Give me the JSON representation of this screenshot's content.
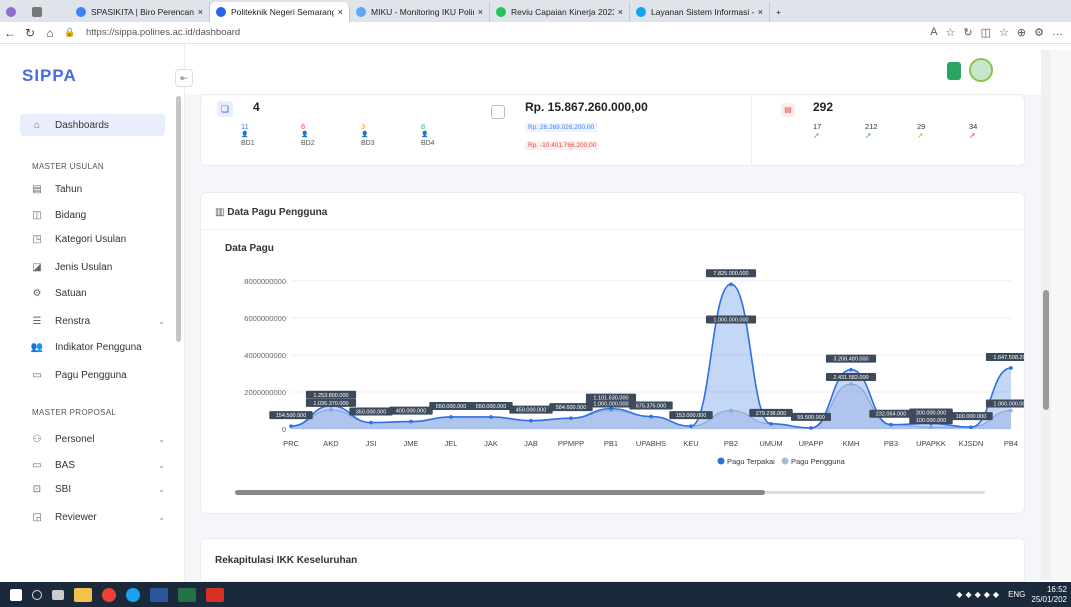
{
  "browser": {
    "tabs": [
      {
        "label": "SPASIKITA | Biro Perencanaan",
        "color": "#3b82f6",
        "active": false
      },
      {
        "label": "Politeknik Negeri Semarang - Da",
        "color": "#2563eb",
        "active": true
      },
      {
        "label": "MIKU - Monitoring IKU Polines",
        "color": "#60a5fa",
        "active": false
      },
      {
        "label": "Reviu Capaian Kinerja 2023 - Ren",
        "color": "#22c55e",
        "active": false
      },
      {
        "label": "Layanan Sistem Informasi - POLI",
        "color": "#0ea5e9",
        "active": false
      }
    ],
    "url": "https://sippa.polines.ac.id/dashboard"
  },
  "sidebar": {
    "logo": "SIPPA",
    "collapse_icon": "⇤",
    "items": [
      {
        "label": "Dashboards",
        "icon": "⌂",
        "active": true
      },
      {
        "label": "Tahun",
        "icon": "▤"
      },
      {
        "label": "Bidang",
        "icon": "◫"
      },
      {
        "label": "Kategori Usulan",
        "icon": "◳"
      },
      {
        "label": "Jenis Usulan",
        "icon": "◪"
      },
      {
        "label": "Satuan",
        "icon": "⚙"
      },
      {
        "label": "Renstra",
        "icon": "☰",
        "chev": "⌄"
      },
      {
        "label": "Indikator Pengguna",
        "icon": "👥"
      },
      {
        "label": "Pagu Pengguna",
        "icon": "▭"
      },
      {
        "label": "Personel",
        "icon": "⚇",
        "chev": "⌄"
      },
      {
        "label": "BAS",
        "icon": "▭",
        "chev": "⌄"
      },
      {
        "label": "SBI",
        "icon": "⊡",
        "chev": "⌄"
      },
      {
        "label": "Reviewer",
        "icon": "◲",
        "chev": "⌄"
      }
    ],
    "section_usulan": "MASTER USULAN",
    "section_proposal": "MASTER PROPOSAL"
  },
  "stats": {
    "bidang_count": "4",
    "bd": [
      {
        "value": "11",
        "label": "BD1",
        "color": "#3b82f6"
      },
      {
        "value": "6",
        "label": "BD2",
        "color": "#ef4444"
      },
      {
        "value": "3",
        "label": "BD3",
        "color": "#f59e0b"
      },
      {
        "value": "8",
        "label": "BD4",
        "color": "#22c55e"
      }
    ],
    "pagu_total": "Rp. 15.867.260.000,00",
    "pagu_used": "Rp. 26.269.026.200,00",
    "pagu_remaining": "Rp. -10.401.766.200,00",
    "usulan_count": "292",
    "usulan_breakdown": [
      {
        "value": "17",
        "color": "#888"
      },
      {
        "value": "212",
        "color": "#22c55e"
      },
      {
        "value": "29",
        "color": "#f59e0b"
      },
      {
        "value": "34",
        "color": "#ef4444"
      }
    ]
  },
  "main": {
    "section_title": "Data Pagu Pengguna",
    "rekap_title": "Rekapitulasi IKK Keseluruhan"
  },
  "chart_data": {
    "type": "area",
    "title": "Data Pagu",
    "categories": [
      "PRC",
      "AKD",
      "JSI",
      "JME",
      "JEL",
      "JAK",
      "JAB",
      "PPMPP",
      "PB1",
      "UPABHS",
      "KEU",
      "PB2",
      "UMUM",
      "UPAPP",
      "KMH",
      "PB3",
      "UPAPKK",
      "KJSDN",
      "PB4"
    ],
    "ylim": [
      0,
      8000000000
    ],
    "yticks": [
      "0",
      "2000000000",
      "4000000000",
      "6000000000",
      "8000000000"
    ],
    "series": [
      {
        "name": "Pagu Terpakai",
        "color": "#2f6fe4",
        "values": [
          154500000,
          1253800000,
          350000000,
          400000000,
          650000000,
          650000000,
          450000000,
          584600000,
          1101630000,
          675375000,
          153000000,
          7825000000,
          279238000,
          59500000,
          3208480000,
          232064000,
          300000000,
          100000000,
          3300000000
        ]
      },
      {
        "name": "Pagu Pengguna",
        "color": "#a9b9d8",
        "values": [
          154500000,
          1036370000,
          350000000,
          400000000,
          650000000,
          650000000,
          450000000,
          584600000,
          1000000000,
          675375000,
          153000000,
          1000000000,
          279238000,
          59500000,
          2431582000,
          232064000,
          100000000,
          100000000,
          1000000000
        ]
      }
    ],
    "labels": [
      "154.500.000",
      "1.253.800.000",
      "350.000.000",
      "400.000.000",
      "650.000.000",
      "650.000.000",
      "450.000.000",
      "584.600.000",
      "1.101.630.000",
      "675.375.000",
      "153.000.000",
      "7.825.000.000",
      "279.238.000",
      "59.500.000",
      "3.208.480.000",
      "232.064.000",
      "300.000.000",
      "100.000.000",
      "1.647.508.200",
      "1.036.370.000",
      "1.000.000.000",
      "1.000.000.000",
      "2.431.582.000",
      "100.000.000",
      "1.000.000.000"
    ],
    "legend": "bottom"
  },
  "taskbar": {
    "lang": "ENG",
    "time": "16:52",
    "date": "25/01/202"
  }
}
